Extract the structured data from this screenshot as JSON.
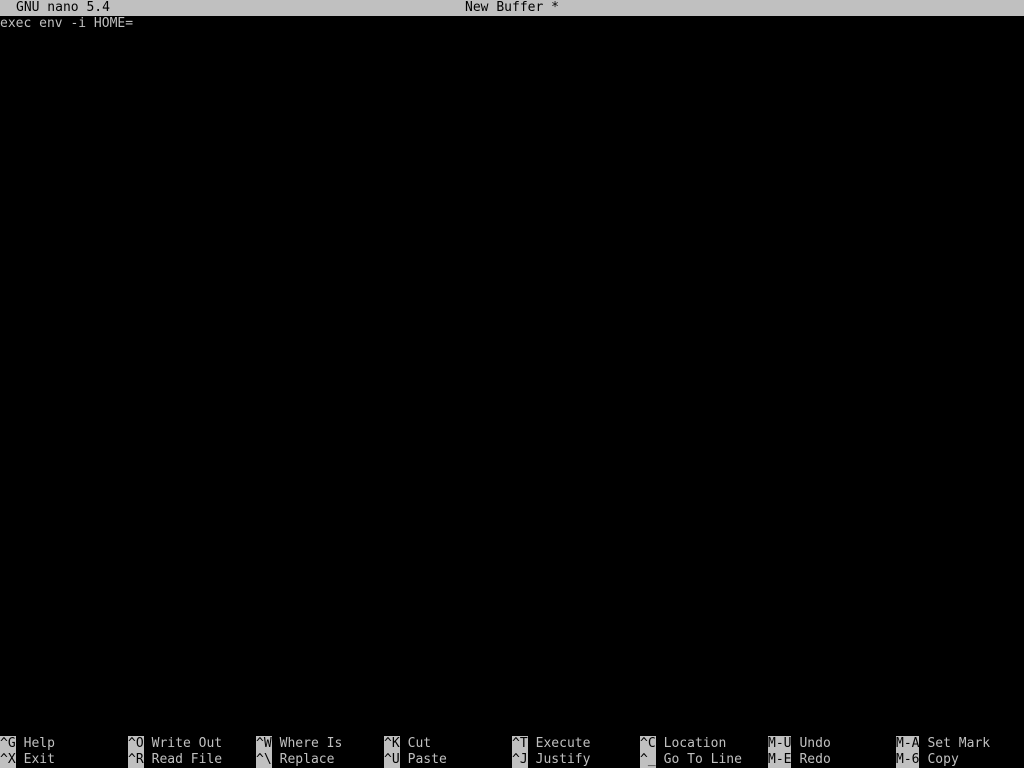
{
  "title_bar": {
    "app_name": "GNU nano 5.4",
    "file_name": "New Buffer *"
  },
  "editor": {
    "lines": [
      "exec env -i HOME="
    ]
  },
  "shortcuts": {
    "row1": [
      {
        "key": "^G",
        "label": "Help"
      },
      {
        "key": "^O",
        "label": "Write Out"
      },
      {
        "key": "^W",
        "label": "Where Is"
      },
      {
        "key": "^K",
        "label": "Cut"
      },
      {
        "key": "^T",
        "label": "Execute"
      },
      {
        "key": "^C",
        "label": "Location"
      },
      {
        "key": "M-U",
        "label": "Undo"
      },
      {
        "key": "M-A",
        "label": "Set Mark"
      }
    ],
    "row2": [
      {
        "key": "^X",
        "label": "Exit"
      },
      {
        "key": "^R",
        "label": "Read File"
      },
      {
        "key": "^\\",
        "label": "Replace"
      },
      {
        "key": "^U",
        "label": "Paste"
      },
      {
        "key": "^J",
        "label": "Justify"
      },
      {
        "key": "^_",
        "label": "Go To Line"
      },
      {
        "key": "M-E",
        "label": "Redo"
      },
      {
        "key": "M-6",
        "label": "Copy"
      }
    ]
  },
  "colors": {
    "background": "#000000",
    "foreground": "#c0c0c0",
    "inverse_bg": "#c0c0c0",
    "inverse_fg": "#000000"
  }
}
